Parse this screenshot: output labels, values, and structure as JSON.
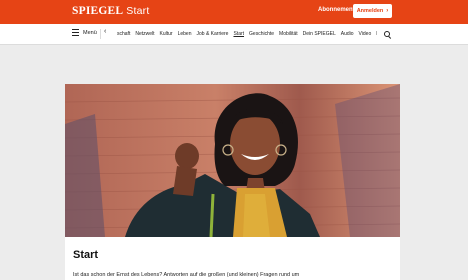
{
  "header": {
    "brand": "SPIEGEL",
    "section": "Start",
    "abo_label": "Abonnement",
    "login_label": "Anmelden",
    "login_chevron": "›"
  },
  "nav": {
    "menu_label": "Menü",
    "prev_arrow": "‹",
    "items": [
      "schaft",
      "Netzwelt",
      "Kultur",
      "Leben",
      "Job & Karriere",
      "Start",
      "Geschichte",
      "Mobilität",
      "Dein SPIEGEL",
      "Audio",
      "Video",
      "English"
    ],
    "active_item": "Start"
  },
  "article": {
    "title": "Start",
    "teaser": "Ist das schon der Ernst des Lebens? Antworten auf die großen (und kleinen) Fragen rund um"
  },
  "colors": {
    "brand": "#e64415",
    "background": "#ececec",
    "nav_background": "#ffffff"
  },
  "icons": [
    "menu-icon",
    "chevron-left-icon",
    "search-icon",
    "chevron-right-icon"
  ]
}
